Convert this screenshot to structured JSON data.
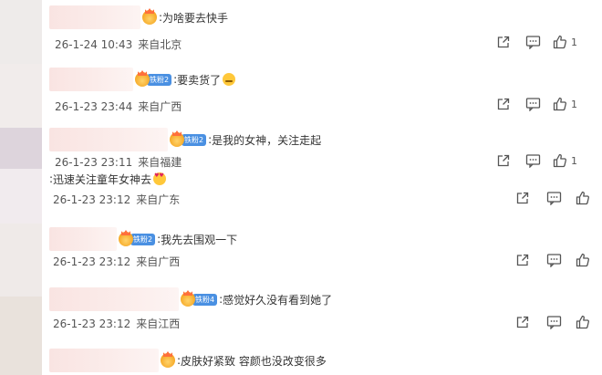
{
  "comments": [
    {
      "text": "为啥要去快手",
      "fan_badge": "",
      "emoji": "",
      "date": "26-1-24 10:43",
      "location": "来自北京",
      "likes": "1"
    },
    {
      "text": "要卖货了",
      "fan_badge": "铁粉2",
      "emoji": "smirk-emoji",
      "date": "26-1-23 23:44",
      "location": "来自广西",
      "likes": "1"
    },
    {
      "text": "是我的女神，关注走起",
      "fan_badge": "铁粉2",
      "emoji": "",
      "date": "26-1-23 23:11",
      "location": "来自福建",
      "likes": "1"
    },
    {
      "text": "迅速关注童年女神去",
      "fan_badge": "",
      "emoji": "heart-eyes-emoji",
      "date": "26-1-23 23:12",
      "location": "来自广东",
      "likes": ""
    },
    {
      "text": "我先去围观一下",
      "fan_badge": "铁粉2",
      "emoji": "",
      "date": "26-1-23 23:12",
      "location": "来自广西",
      "likes": ""
    },
    {
      "text": "感觉好久没有看到她了",
      "fan_badge": "铁粉4",
      "emoji": "",
      "date": "26-1-23 23:12",
      "location": "来自江西",
      "likes": ""
    },
    {
      "text": "皮肤好紧致 容颜也没改变很多",
      "fan_badge": "",
      "emoji": "",
      "date": "",
      "location": "",
      "likes": ""
    }
  ],
  "icons": {
    "share": "share-icon",
    "comment": "comment-icon",
    "like": "like-icon"
  },
  "colors": {
    "fan_badge": "#4a90e2",
    "crown": "#f5a623"
  }
}
